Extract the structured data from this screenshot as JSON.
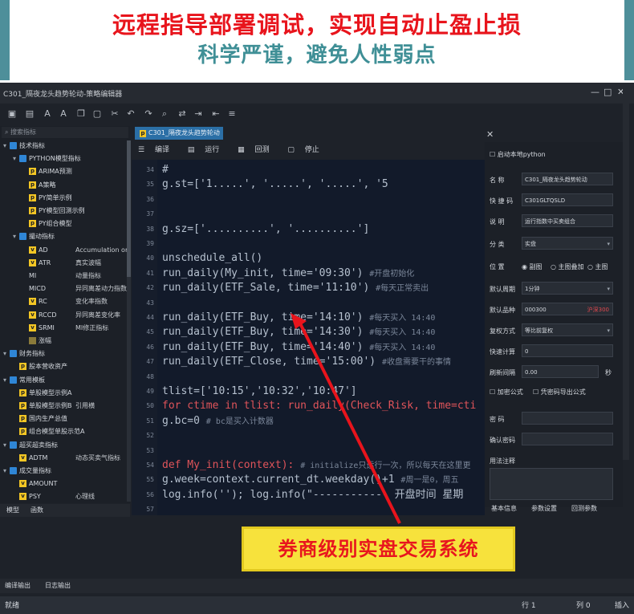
{
  "banner": {
    "line1": "远程指导部署调试，实现自动止盈止损",
    "line2": "科学严谨，避免人性弱点"
  },
  "window": {
    "title": "C301_隔夜龙头趋势轮动-策略编辑器",
    "controls": [
      "—",
      "□",
      "✕"
    ]
  },
  "toolbar": {
    "icons": [
      "save-icon",
      "save-all-icon",
      "font-decrease-icon",
      "font-increase-icon",
      "copy-icon",
      "paste-icon",
      "cut-icon",
      "undo-icon",
      "redo-icon",
      "find-icon",
      "replace-icon",
      "indent-icon",
      "outdent-icon",
      "comment-icon"
    ]
  },
  "left": {
    "search_placeholder": "搜索指标",
    "tree": [
      {
        "label": "技术指标",
        "type": "folder",
        "level": 0
      },
      {
        "label": "PYTHON模型指标",
        "type": "folder",
        "level": 1
      },
      {
        "label": "ARIMA预测",
        "type": "p",
        "level": 2
      },
      {
        "label": "A策略",
        "type": "p",
        "level": 2
      },
      {
        "label": "PY简单示例",
        "type": "p",
        "level": 2
      },
      {
        "label": "PY模型回测示例",
        "type": "p",
        "level": 2
      },
      {
        "label": "PY组合模型",
        "type": "p",
        "level": 2
      },
      {
        "label": "撮动指标",
        "type": "folder",
        "level": 1
      },
      {
        "label": "AD",
        "extra": "Accumulation or",
        "type": "v",
        "level": 2
      },
      {
        "label": "ATR",
        "extra": "真实波幅",
        "type": "v",
        "level": 2
      },
      {
        "label": "MI",
        "extra": "动量指标",
        "type": "none",
        "level": 2
      },
      {
        "label": "MICD",
        "extra": "异同离差动力指数",
        "type": "none",
        "level": 2
      },
      {
        "label": "RC",
        "extra": "变化率指数",
        "type": "v",
        "level": 2
      },
      {
        "label": "RCCD",
        "extra": "异同离差变化率",
        "type": "v",
        "level": 2
      },
      {
        "label": "SRMI",
        "extra": "MI修正指标",
        "type": "v",
        "level": 2
      },
      {
        "label": "涨幅",
        "type": "b",
        "level": 2
      },
      {
        "label": "财务指标",
        "type": "folder",
        "level": 0
      },
      {
        "label": "股本营收资产",
        "type": "p",
        "level": 1
      },
      {
        "label": "常用模板",
        "type": "folder",
        "level": 0
      },
      {
        "label": "单股模型示例A",
        "type": "p",
        "level": 1
      },
      {
        "label": "单股模型示例B",
        "extra": "引用横",
        "type": "p",
        "level": 1
      },
      {
        "label": "国内生产总值",
        "type": "p",
        "level": 1
      },
      {
        "label": "组合模型单股示范A",
        "type": "p",
        "level": 1
      },
      {
        "label": "超买超卖指标",
        "type": "folder",
        "level": 0
      },
      {
        "label": "ADTM",
        "extra": "动态买卖气指标",
        "type": "v",
        "level": 1
      },
      {
        "label": "成交量指标",
        "type": "folder",
        "level": 0
      },
      {
        "label": "AMOUNT",
        "type": "v",
        "level": 1
      },
      {
        "label": "PSY",
        "extra": "心理线",
        "type": "v",
        "level": 1
      }
    ],
    "tabs": [
      "模型",
      "函数"
    ]
  },
  "editor": {
    "tab": "C301_隔夜龙头趋势轮动",
    "tools": [
      "编译",
      "运行",
      "回测",
      "停止"
    ],
    "lines": [
      {
        "n": "34",
        "t": "    #"
      },
      {
        "n": "35",
        "t": "    g.st=['1.....', '.....', '.....', '5"
      },
      {
        "n": "36",
        "t": ""
      },
      {
        "n": "37",
        "t": ""
      },
      {
        "n": "38",
        "t": "    g.sz=['..........', '..........']"
      },
      {
        "n": "39",
        "t": ""
      },
      {
        "n": "40",
        "t": "    unschedule_all()"
      },
      {
        "n": "41",
        "t": "    run_daily(My_init,    time='09:30')",
        "c": "#开盘初始化"
      },
      {
        "n": "42",
        "t": "    run_daily(ETF_Sale,   time='11:10')",
        "c": "#每天正常卖出"
      },
      {
        "n": "43",
        "t": ""
      },
      {
        "n": "44",
        "t": "    run_daily(ETF_Buy,    time='14:10')",
        "c": "#每天买入 14:40"
      },
      {
        "n": "45",
        "t": "    run_daily(ETF_Buy,    time='14:30')",
        "c": "#每天买入 14:40"
      },
      {
        "n": "46",
        "t": "    run_daily(ETF_Buy,    time='14:40')",
        "c": "#每天买入 14:40"
      },
      {
        "n": "47",
        "t": "    run_daily(ETF_Close,  time='15:00')",
        "c": "#收盘需要干的事情"
      },
      {
        "n": "48",
        "t": ""
      },
      {
        "n": "49",
        "t": "    tlist=['10:15','10:32','10:47']"
      },
      {
        "n": "50",
        "t": "    for ctime in tlist: run_daily(Check_Risk, time=cti"
      },
      {
        "n": "51",
        "t": "    g.bc=0",
        "c": "# bc是买入计数器"
      },
      {
        "n": "52",
        "t": ""
      },
      {
        "n": "53",
        "t": ""
      },
      {
        "n": "54",
        "t": "def My_init(context):",
        "c": "# initialize只运行一次，所以每天在这里更"
      },
      {
        "n": "55",
        "t": "    g.week=context.current_dt.weekday()+1",
        "c": "#周一是0，周五"
      },
      {
        "n": "56",
        "t": "    log.info(''); log.info(\"------------ 开盘时间  星期"
      },
      {
        "n": "57",
        "t": ""
      }
    ]
  },
  "right": {
    "local_checkbox": "启动本地python",
    "fields": [
      {
        "label": "名    称",
        "value": "C301_隔夜龙头趋势轮动"
      },
      {
        "label": "快 捷 码",
        "value": "C301GLTQSLD"
      },
      {
        "label": "说    明",
        "value": "运行指数中买卖组合"
      },
      {
        "label": "分    类",
        "value": "实盘"
      }
    ],
    "position_label": "位    置",
    "position_options": [
      "副图",
      "主图叠加",
      "主图"
    ],
    "period_label": "默认周期",
    "period_value": "1分钟",
    "stock_label": "默认品种",
    "stock_value": "000300",
    "stock_tag": "沪深300",
    "adjust_label": "复权方式",
    "adjust_value": "等比前复权",
    "calc_label": "快速计算",
    "calc_value": "0",
    "interval_label": "刷新间隔",
    "interval_value": "0.00",
    "interval_unit": "秒",
    "encrypt_label": "加密公式",
    "export_label": "凭密码导出公式",
    "password_label": "密    码",
    "confirm_label": "确认密码",
    "notes_label": "用法注释",
    "tabs": [
      "基本信息",
      "参数设置",
      "回测参数"
    ]
  },
  "output": {
    "tabs": [
      "编译输出",
      "日志输出"
    ]
  },
  "status": {
    "left": "就绪",
    "line": "行 1",
    "col": "列 0",
    "mode": "插入"
  },
  "callout": {
    "text": "券商级别实盘交易系统"
  },
  "colors": {
    "banner_red": "#e8141c",
    "banner_teal": "#3f8f96",
    "callout_bg": "#f7e23c",
    "arrow": "#e8141c"
  }
}
